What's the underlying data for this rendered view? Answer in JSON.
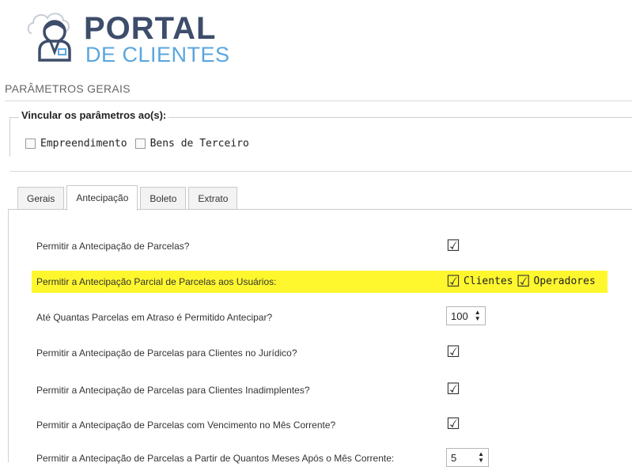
{
  "brand": {
    "title": "PORTAL",
    "subtitle": "DE CLIENTES",
    "primary_color": "#3d4d6a",
    "accent_color": "#5aa6df"
  },
  "page": {
    "section_title": "PARÂMETROS GERAIS"
  },
  "link_params": {
    "legend": "Vincular os parâmetros ao(s):",
    "options": [
      {
        "label": "Empreendimento",
        "checked": false
      },
      {
        "label": "Bens de Terceiro",
        "checked": false
      }
    ]
  },
  "tabs": [
    {
      "label": "Gerais",
      "active": false
    },
    {
      "label": "Antecipação",
      "active": true
    },
    {
      "label": "Boleto",
      "active": false
    },
    {
      "label": "Extrato",
      "active": false
    }
  ],
  "rows": [
    {
      "label": "Permitir a Antecipação de Parcelas?",
      "type": "checkbox",
      "checked": true
    },
    {
      "label": "Permitir a Antecipação Parcial de Parcelas aos Usuários:",
      "type": "multi",
      "highlight_color": "#fff72e",
      "options": [
        {
          "label": "Clientes",
          "checked": true
        },
        {
          "label": "Operadores",
          "checked": true
        }
      ]
    },
    {
      "label": "Até Quantas Parcelas em Atraso é Permitido Antecipar?",
      "type": "spinner",
      "value": "100"
    },
    {
      "label": "Permitir a Antecipação de Parcelas para Clientes no Jurídico?",
      "type": "checkbox",
      "checked": true
    },
    {
      "label": "Permitir a Antecipação de Parcelas para Clientes Inadimplentes?",
      "type": "checkbox",
      "checked": true
    },
    {
      "label": "Permitir a Antecipação de Parcelas com Vencimento no Mês Corrente?",
      "type": "checkbox",
      "checked": true
    },
    {
      "label": "Permitir a Antecipação de Parcelas a Partir de Quantos Meses Após o Mês Corrente:",
      "type": "spinner",
      "value": "5"
    }
  ]
}
